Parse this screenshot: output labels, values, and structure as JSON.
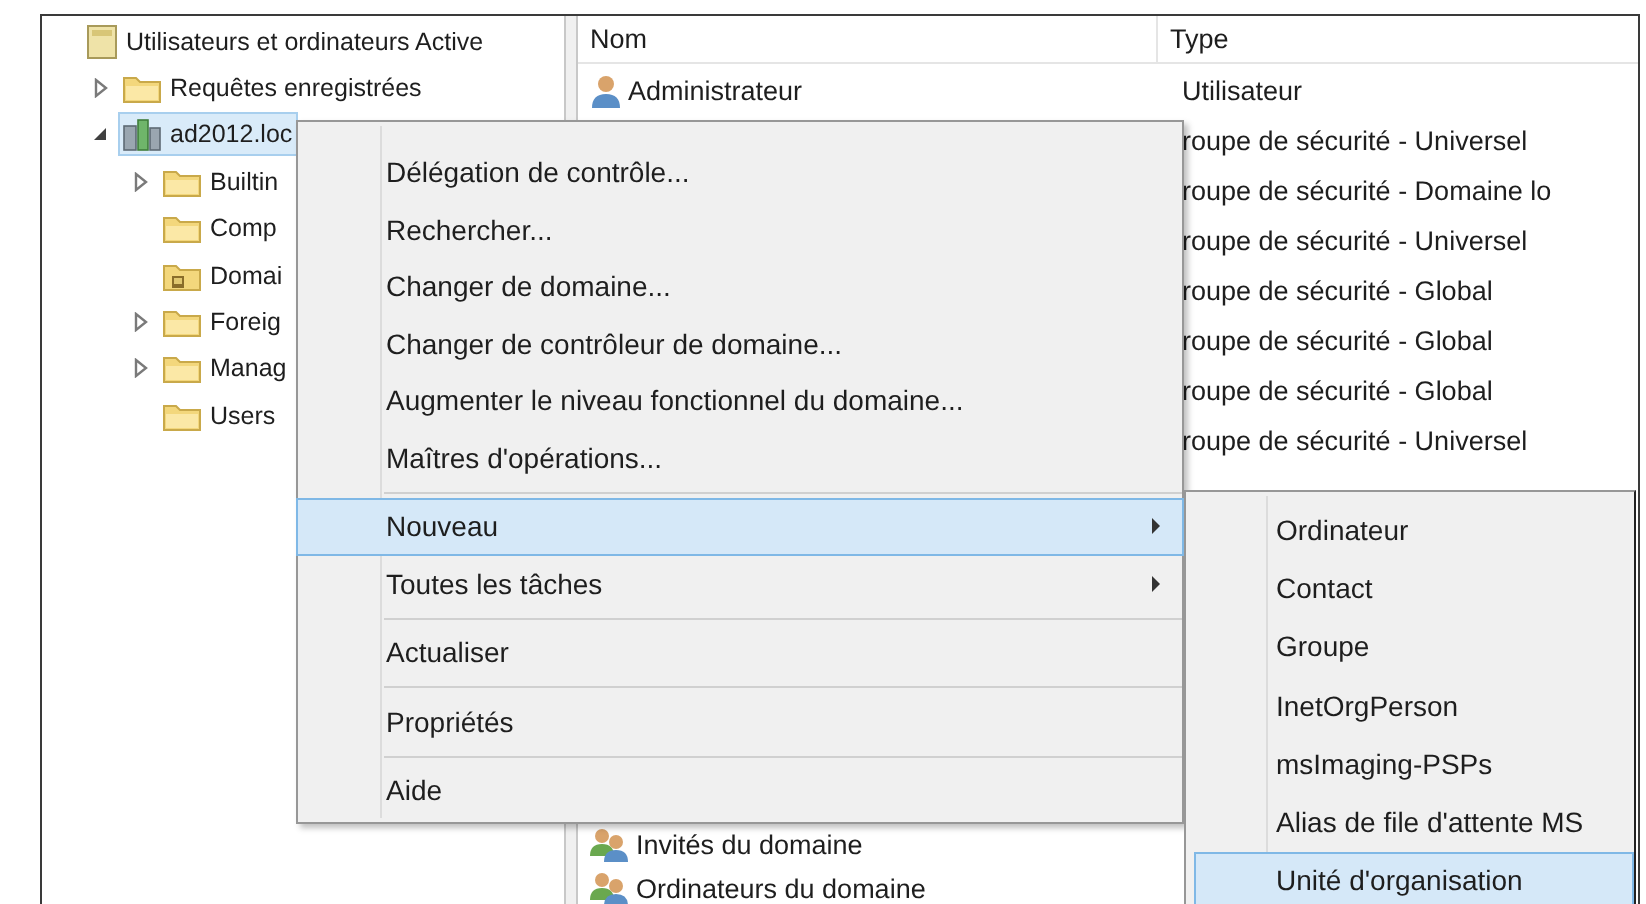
{
  "tree": {
    "label": "Utilisateurs et ordinateurs Active",
    "kind": "console",
    "selected": false,
    "children": [
      {
        "label": "Requêtes enregistrées",
        "kind": "folder",
        "expanded": false,
        "selected": false
      },
      {
        "label": "ad2012.loc",
        "kind": "domain",
        "expanded": true,
        "selected": true,
        "children": [
          {
            "label": "Builtin",
            "kind": "folder",
            "expanded": false,
            "selected": false
          },
          {
            "label": "Comp",
            "kind": "folder",
            "selected": false
          },
          {
            "label": "Domai",
            "kind": "ou",
            "selected": false
          },
          {
            "label": "Foreig",
            "kind": "folder",
            "expanded": false,
            "selected": false
          },
          {
            "label": "Manag",
            "kind": "folder",
            "expanded": false,
            "selected": false
          },
          {
            "label": "Users",
            "kind": "folder",
            "selected": false
          }
        ]
      }
    ]
  },
  "table": {
    "columns": [
      "Nom",
      "Type"
    ],
    "rows": [
      {
        "name": "Administrateur",
        "type": "Utilisateur",
        "kind": "user"
      },
      {
        "type": "roupe de sécurité - Universel"
      },
      {
        "type": "roupe de sécurité - Domaine lo"
      },
      {
        "type": "roupe de sécurité - Universel"
      },
      {
        "type": "roupe de sécurité - Global"
      },
      {
        "type": "roupe de sécurité - Global"
      },
      {
        "type": "roupe de sécurité - Global"
      },
      {
        "type": "roupe de sécurité - Universel"
      },
      {
        "name": "Invités du domaine",
        "kind": "group"
      },
      {
        "name": "Ordinateurs du domaine",
        "kind": "group"
      }
    ]
  },
  "context_menu": {
    "items": [
      {
        "kind": "item",
        "label": "Délégation de contrôle...",
        "submenu": false,
        "selected": false
      },
      {
        "kind": "item",
        "label": "Rechercher...",
        "submenu": false,
        "selected": false
      },
      {
        "kind": "item",
        "label": "Changer de domaine...",
        "submenu": false,
        "selected": false
      },
      {
        "kind": "item",
        "label": "Changer de contrôleur de domaine...",
        "submenu": false,
        "selected": false
      },
      {
        "kind": "item",
        "label": "Augmenter le niveau fonctionnel du domaine...",
        "submenu": false,
        "selected": false
      },
      {
        "kind": "item",
        "label": "Maîtres d'opérations...",
        "submenu": false,
        "selected": false
      },
      {
        "kind": "separator"
      },
      {
        "kind": "item",
        "label": "Nouveau",
        "submenu": true,
        "selected": true
      },
      {
        "kind": "item",
        "label": "Toutes les tâches",
        "submenu": true,
        "selected": false
      },
      {
        "kind": "separator"
      },
      {
        "kind": "item",
        "label": "Actualiser",
        "submenu": false,
        "selected": false
      },
      {
        "kind": "separator"
      },
      {
        "kind": "item",
        "label": "Propriétés",
        "submenu": false,
        "selected": false
      },
      {
        "kind": "separator"
      },
      {
        "kind": "item",
        "label": "Aide",
        "submenu": false,
        "selected": false
      }
    ]
  },
  "submenu": {
    "items": [
      {
        "label": "Ordinateur",
        "selected": false
      },
      {
        "label": "Contact",
        "selected": false
      },
      {
        "label": "Groupe",
        "selected": false
      },
      {
        "label": "InetOrgPerson",
        "selected": false
      },
      {
        "label": "msImaging-PSPs",
        "selected": false
      },
      {
        "label": "Alias de file d'attente MS",
        "selected": false
      },
      {
        "label": "Unité d'organisation",
        "selected": true
      }
    ]
  }
}
